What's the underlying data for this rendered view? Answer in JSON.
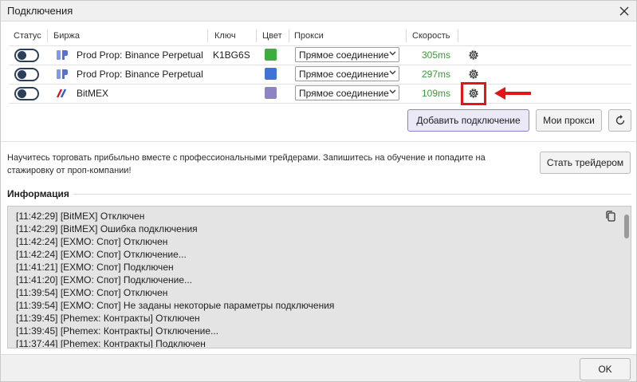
{
  "window": {
    "title": "Подключения"
  },
  "table": {
    "headers": {
      "status": "Статус",
      "exchange": "Биржа",
      "key": "Ключ",
      "color": "Цвет",
      "proxy": "Прокси",
      "speed": "Скорость"
    },
    "rows": [
      {
        "exchange": "Prod Prop: Binance Perpetual",
        "key": "K1BG6S",
        "color": "#3cae3c",
        "proxy": "Прямое соединение",
        "speed": "305ms",
        "enabled": false,
        "icon": "prop-logo-icon"
      },
      {
        "exchange": "Prod Prop: Binance Perpetual",
        "key": "",
        "color": "#3f74d6",
        "proxy": "Прямое соединение",
        "speed": "297ms",
        "enabled": false,
        "icon": "prop-logo-icon"
      },
      {
        "exchange": "BitMEX",
        "key": "",
        "color": "#8d84c4",
        "proxy": "Прямое соединение",
        "speed": "109ms",
        "enabled": false,
        "icon": "bitmex-logo-icon"
      }
    ]
  },
  "actions": {
    "add_connection": "Добавить подключение",
    "my_proxies": "Мои прокси"
  },
  "promo": {
    "text": "Научитесь торговать прибыльно вместе с профессиональными трейдерами. Запишитесь на обучение и попадите на стажировку от проп-компании!",
    "button": "Стать трейдером"
  },
  "info": {
    "heading": "Информация",
    "log": [
      "[11:42:29] [BitMEX] Отключен",
      "[11:42:29] [BitMEX] Ошибка подключения",
      "[11:42:24] [EXMO: Спот] Отключен",
      "[11:42:24] [EXMO: Спот] Отключение...",
      "[11:41:21] [EXMO: Спот] Подключен",
      "[11:41:20] [EXMO: Спот] Подключение...",
      "[11:39:54] [EXMO: Спот] Отключен",
      "[11:39:54] [EXMO: Спот] Не заданы некоторые параметры подключения",
      "[11:39:45] [Phemex: Контракты] Отключен",
      "[11:39:45] [Phemex: Контракты] Отключение...",
      "[11:37:44] [Phemex: Контракты] Подключен"
    ]
  },
  "footer": {
    "ok": "OK"
  },
  "colors": {
    "speed": "#3a9a3a",
    "highlight": "#e5141b",
    "toggle": "#2c3e5a"
  }
}
